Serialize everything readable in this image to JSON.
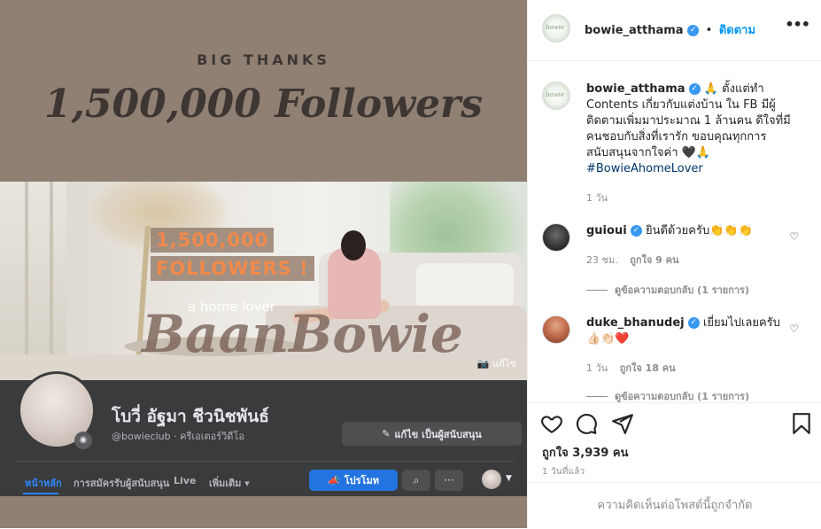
{
  "post_image": {
    "headline_top": "BIG THANKS",
    "headline_main": "1,500,000 Followers",
    "cover": {
      "followers_line1": "1,500,000",
      "followers_line2": "FOLLOWERS !",
      "tagline": "a home lover",
      "brand": "BaanBowie",
      "edit_label": "แก้ไข"
    },
    "fb_profile": {
      "name": "โบวี่ อัฐมา ชีวนิชพันธ์",
      "handle": "@bowieclub · ครีเอเตอร์วิดีโอ",
      "edit_button": "แก้ไข เป็นผู้สนับสนุน",
      "tabs": [
        "หน้าหลัก",
        "การสมัครรับผู้สนับสนุน",
        "Live",
        "เพิ่มเติม"
      ],
      "promote_button": "โปรโมท"
    }
  },
  "header": {
    "username": "bowie_atthama",
    "separator": "•",
    "follow_label": "ติดตาม"
  },
  "caption": {
    "username": "bowie_atthama",
    "text": " 🙏 ตั้งแต่ทำ Contents เกี่ยวกับแต่งบ้าน ใน FB มีผู้ติดตามเพิ่มมาประมาณ 1 ล้านคน ดีใจที่มีคนชอบกับสิ่งที่เรารัก ขอบคุณทุกการสนับสนุนจากใจค่า 🖤🙏",
    "hashtag": "#BowieAhomeLover",
    "age": "1 วัน"
  },
  "comments": [
    {
      "username": "guioui",
      "text": "ยินดีด้วยครับ👏👏👏",
      "age": "23 ชม.",
      "likes": "ถูกใจ 9 คน",
      "replies": "ดูข้อความตอบกลับ (1 รายการ)"
    },
    {
      "username": "duke_bhanudej",
      "text": "เยี่ยมไปเลยครับ👍🏻👏🏻❤️",
      "age": "1 วัน",
      "likes": "ถูกใจ 18 คน",
      "replies": "ดูข้อความตอบกลับ (1 รายการ)"
    }
  ],
  "actions": {
    "likes": "ถูกใจ 3,939 คน",
    "time_ago": "1 วันที่แล้ว"
  },
  "comments_limited": "ความคิดเห็นต่อโพสต์นี้ถูกจำกัด",
  "icons": {
    "like": "heart-icon",
    "comment": "comment-bubble-icon",
    "share": "paper-plane-icon",
    "save": "bookmark-icon",
    "verified": "verified-badge-icon",
    "more": "more-options-icon"
  },
  "colors": {
    "accent_link": "#0095f6",
    "verified": "#3897f0",
    "image_bg": "#8f8073",
    "fb_dark": "#3a3b3c",
    "fb_blue": "#2374e1"
  }
}
